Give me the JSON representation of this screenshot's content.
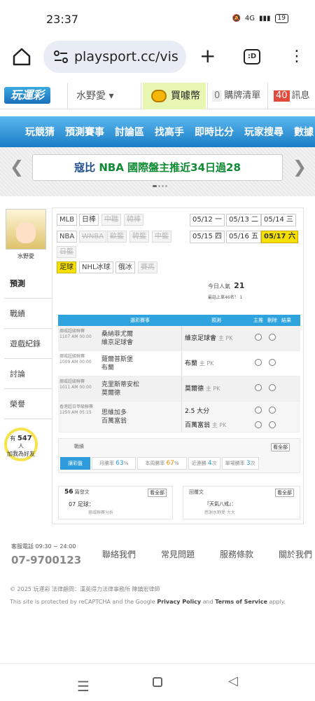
{
  "status_bar": {
    "time": "23:37",
    "network": "4G",
    "battery": "19"
  },
  "browser": {
    "url": "playsport.cc/visit",
    "tab_count": ":D"
  },
  "site_header": {
    "logo": "玩運彩",
    "username": "水野愛 ▾",
    "buy_coins": "買噱幣",
    "cart_count": "0",
    "cart_label": "購牌清單",
    "msg_count": "40",
    "msg_label": "訊息"
  },
  "main_nav": [
    "玩競猜",
    "預測賽事",
    "討論區",
    "找高手",
    "即時比分",
    "玩家搜尋",
    "數據"
  ],
  "banner": {
    "prefix": "寇比",
    "highlight": "NBA 國際盤主推近34日過28"
  },
  "profile": {
    "name": "水野愛"
  },
  "side_tabs": [
    "預測",
    "戰績",
    "遊戲紀錄",
    "討論",
    "榮譽"
  ],
  "bulb": {
    "prefix": "有",
    "count": "547",
    "suffix": "人",
    "line2": "加我為好友"
  },
  "leagues": [
    {
      "label": "MLB",
      "state": "on"
    },
    {
      "label": "日棒",
      "state": "on"
    },
    {
      "label": "中職",
      "state": "off"
    },
    {
      "label": "韓棒",
      "state": "off"
    },
    {
      "label": "NBA",
      "state": "on"
    },
    {
      "label": "WNBA",
      "state": "off"
    },
    {
      "label": "歐籃",
      "state": "off"
    },
    {
      "label": "韓籃",
      "state": "off"
    },
    {
      "label": "中籃",
      "state": "off"
    },
    {
      "label": "日籃",
      "state": "off"
    },
    {
      "label": "足球",
      "state": "sel"
    },
    {
      "label": "NHL冰球",
      "state": "on"
    },
    {
      "label": "俄冰",
      "state": "on"
    },
    {
      "label": "賽馬",
      "state": "off"
    }
  ],
  "dates": [
    "05/12 一",
    "05/13 二",
    "05/14 三",
    "05/15 四",
    "05/16 五",
    "05/17 六"
  ],
  "stats": {
    "today_label": "今日人氣",
    "today": "21",
    "rank_text": "最話上單46名！ 1"
  },
  "table": {
    "headers": [
      "",
      "選彩賽事",
      "",
      "預測",
      "主推",
      "刪除",
      "結果"
    ],
    "rows": [
      {
        "league": "挪威超級聯賽",
        "time": "1107 AM 00:00",
        "teams": [
          "桑納菲尤爾",
          "維京足球會"
        ],
        "pick": "維京足球會",
        "pick_tag": "主 PK"
      },
      {
        "league": "挪威超級聯賽",
        "time": "1009 AM 00:00",
        "teams": [
          "薩爾普斯堡",
          "布蘭"
        ],
        "pick": "布蘭",
        "pick_tag": "主 PK"
      },
      {
        "league": "挪威超級聯賽",
        "time": "1011 AM 00:00",
        "teams": [
          "克里斯蒂安松",
          "莫爾德"
        ],
        "pick": "莫爾德",
        "pick_tag": "主 PK"
      },
      {
        "league": "香港超日甲級聯賽",
        "time": "1250 AM 05:15",
        "teams": [
          "思維加多",
          "百萬富翁"
        ],
        "pick": "2.5 大分",
        "pick_tag": "",
        "pick2": "百萬富翁",
        "pick2_tag": "主 PK"
      }
    ]
  },
  "record": {
    "title": "戰績",
    "more": "看全部",
    "tabs": [
      "讓彩盤",
      "月勝率",
      "63",
      "%",
      "本周勝率",
      "67",
      "%",
      "近連勝",
      "4",
      "次",
      "單場勝率",
      "3",
      "次"
    ]
  },
  "panels": {
    "left": {
      "count": "56",
      "title": "篇發文",
      "more": "看全部",
      "line1": "07 足球：",
      "line2": "挪威聯賽分析"
    },
    "right": {
      "title": "回覆文",
      "more": "看全部",
      "line1": "『天氣八戒』：",
      "line2": "感謝水野愛 大大"
    }
  },
  "footer": {
    "service_hours": "客服電話 09:30 ~ 24:00",
    "phone": "07-9700123",
    "links": [
      "聯絡我們",
      "常見問題",
      "服務條款",
      "關於我們"
    ],
    "copyright": "© 2025 玩運彩 法律顧問：漢英得力法律事務所 陳鎮宏律師",
    "recaptcha_pre": "This site is protected by reCAPTCHA and the Google ",
    "privacy": "Privacy Policy",
    "and": " and ",
    "terms": "Terms of Service",
    "apply": " apply."
  }
}
